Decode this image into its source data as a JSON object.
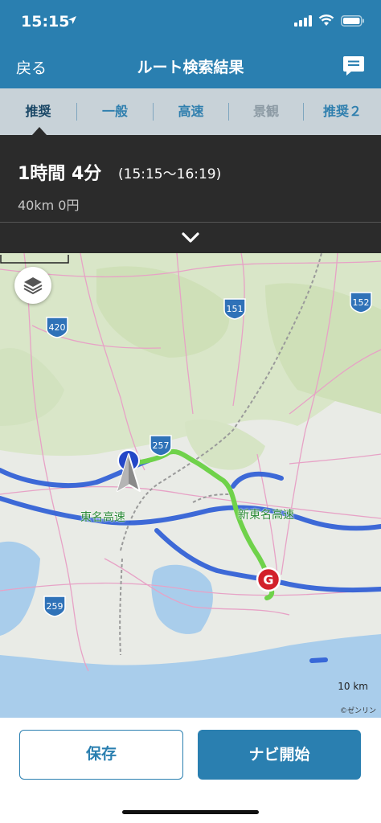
{
  "status_bar": {
    "time": "15:15"
  },
  "nav": {
    "back_label": "戻る",
    "title": "ルート検索結果"
  },
  "tabs": [
    {
      "label": "推奨",
      "state": "active"
    },
    {
      "label": "一般",
      "state": "normal"
    },
    {
      "label": "高速",
      "state": "normal"
    },
    {
      "label": "景観",
      "state": "disabled"
    },
    {
      "label": "推奨２",
      "state": "normal"
    }
  ],
  "summary": {
    "duration": "1時間 4分",
    "time_range": "(15:15〜16:19)",
    "distance_cost": "40km  0円"
  },
  "map": {
    "road_labels": [
      "東名高速",
      "新東名高速"
    ],
    "route_numbers": [
      "151",
      "152",
      "420",
      "257",
      "259"
    ],
    "goal_marker": "G",
    "scale": "10 km",
    "copyright": "©ゼンリン"
  },
  "actions": {
    "save_label": "保存",
    "start_nav_label": "ナビ開始"
  },
  "colors": {
    "header": "#2a7fb0",
    "route": "#6fd24a",
    "highway": "#2f5fd6"
  }
}
